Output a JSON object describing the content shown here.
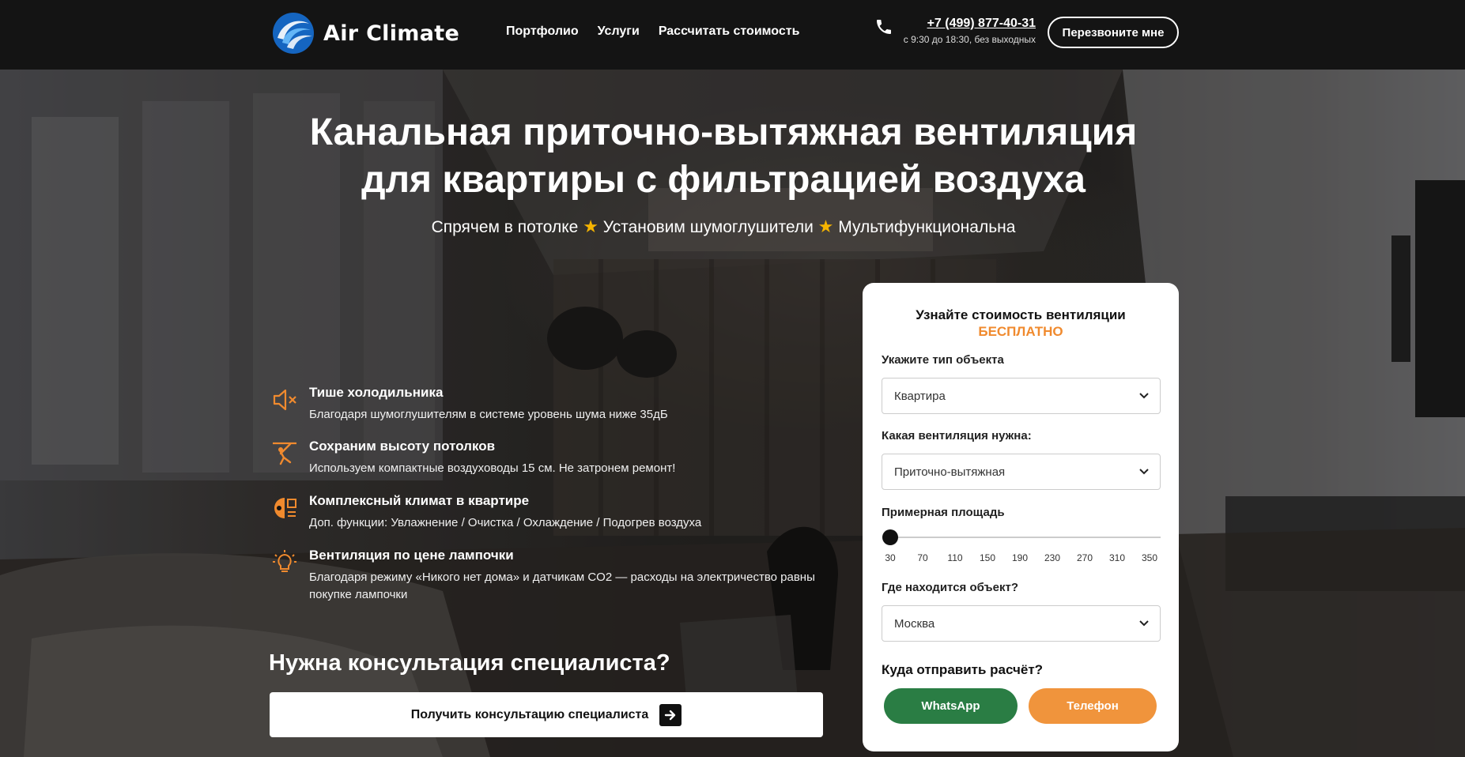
{
  "header": {
    "logo_text": "Air Climate",
    "nav": [
      {
        "label": "Портфолио"
      },
      {
        "label": "Услуги"
      },
      {
        "label": "Рассчитать стоимость"
      }
    ],
    "phone": "+7 (499) 877-40-31",
    "hours": "с 9:30 до 18:30, без выходных",
    "callback_label": "Перезвоните мне"
  },
  "hero": {
    "title_line1": "Канальная приточно-вытяжная вентиляция",
    "title_line2": "для квартиры с фильтрацией воздуха",
    "subtitle_parts": [
      "Спрячем в потолке",
      "Установим шумоглушители",
      "Мультифункциональна"
    ],
    "star_glyph": "★"
  },
  "features": [
    {
      "icon": "mute-speaker-icon",
      "title": "Тише холодильника",
      "text": "Благодаря шумоглушителям в системе уровень шума ниже 35дБ"
    },
    {
      "icon": "ceiling-worker-icon",
      "title": "Сохраним высоту потолков",
      "text": "Используем компактные воздуховоды 15 см. Не затронем ремонт!"
    },
    {
      "icon": "climate-functions-icon",
      "title": "Комплексный климат в квартире",
      "text": "Доп. функции: Увлажнение / Очистка / Охлаждение / Подогрев воздуха"
    },
    {
      "icon": "light-bulb-icon",
      "title": "Вентиляция по цене лампочки",
      "text": "Благодаря режиму «Никого нет дома» и датчикам CO2 — расходы на электричество равны покупке лампочки"
    }
  ],
  "consult": {
    "title": "Нужна консультация специалиста?",
    "button_label": "Получить консультацию специалиста"
  },
  "form": {
    "title": "Узнайте стоимость вентиляции",
    "free_label": "БЕСПЛАТНО",
    "object_type_label": "Укажите тип объекта",
    "object_type_value": "Квартира",
    "ventilation_label": "Какая вентиляция нужна:",
    "ventilation_value": "Приточно-вытяжная",
    "area_label": "Примерная площадь",
    "area_value": 30,
    "area_ticks": [
      "30",
      "70",
      "110",
      "150",
      "190",
      "230",
      "270",
      "310",
      "350"
    ],
    "location_label": "Где находится объект?",
    "location_value": "Москва",
    "send_label": "Куда отправить расчёт?",
    "whatsapp_label": "WhatsApp",
    "phone_label": "Телефон"
  },
  "colors": {
    "accent_orange": "#f08a2e",
    "whatsapp_green": "#2a7d44",
    "phone_orange": "#f0943c",
    "star_gold": "#f5b400",
    "logo_blue": "#1e88e5",
    "header_bg": "#141414"
  }
}
